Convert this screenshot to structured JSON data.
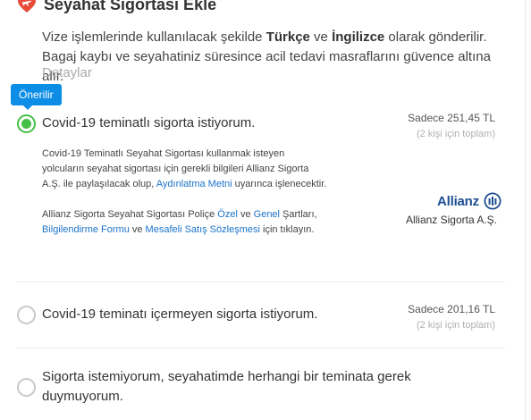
{
  "section": {
    "title": "Seyahat Sigortası Ekle",
    "intro_part1": "Vize işlemlerinde kullanılacak şekilde ",
    "intro_bold1": "Türkçe",
    "intro_part2": " ve ",
    "intro_bold2": "İngilizce",
    "intro_part3": " olarak gönderilir. Bagaj kaybı ve seyahatiniz süresince acil tedavi masraflarını güvence altına alır.",
    "details_link": "Detaylar",
    "accent_color": "#e84b3a"
  },
  "badge": {
    "label": "Önerilir",
    "color": "#0c8ee6"
  },
  "options": [
    {
      "label": "Covid-19 teminatlı sigorta istiyorum.",
      "selected": true,
      "price": "Sadece 251,45 TL",
      "price_note": "(2 kişi için toplam)"
    },
    {
      "label": "Covid-19 teminatı içermeyen sigorta istiyorum.",
      "selected": false,
      "price": "Sadece 201,16 TL",
      "price_note": "(2 kişi için toplam)"
    },
    {
      "label": "Sigorta istemiyorum, seyahatimde herhangi bir teminata gerek duymuyorum.",
      "selected": false
    }
  ],
  "description": {
    "p1_text": "Covid-19 Teminatlı Seyahat Sigortası kullanmak isteyen yolcuların seyahat sigortası için gerekli bilgileri Allianz Sigorta A.Ş. ile paylaşılacak olup, ",
    "p1_link": "Aydınlatma Metni",
    "p1_end": " uyarınca işlenecektir.",
    "p2_text1": "Allianz Sigorta Seyahat Sigortası Poliçe ",
    "p2_link1": "Özel",
    "p2_text2": " ve ",
    "p2_link2": "Genel",
    "p2_text3": " Şartları, ",
    "p2_link3": "Bilgilendirme Formu",
    "p2_text4": " ve ",
    "p2_link4": "Mesafeli Satış Sözleşmesi",
    "p2_text5": " için tıklayın."
  },
  "insurer": {
    "logo_text": "Allianz",
    "company": "Allianz Sigorta A.Ş.",
    "brand_color": "#1d4f91"
  },
  "status_colors": {
    "selected": "#46c046",
    "link": "#1a73c8"
  }
}
